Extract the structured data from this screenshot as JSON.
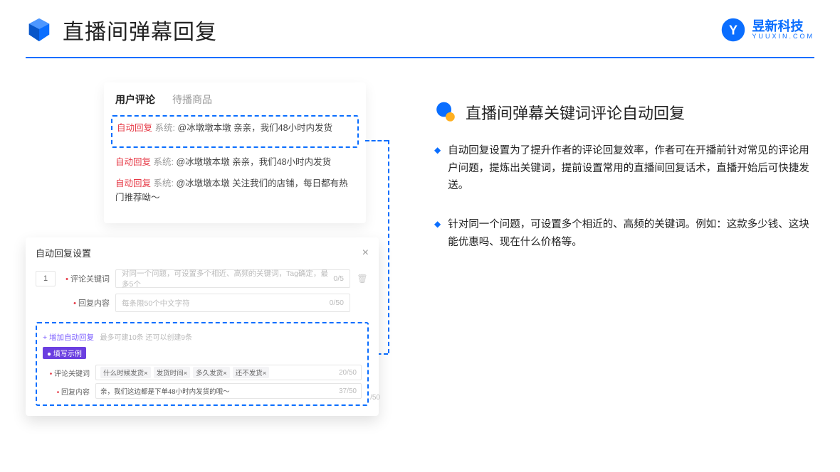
{
  "header": {
    "title": "直播间弹幕回复"
  },
  "logo": {
    "name": "昱新科技",
    "sub": "YUUXIN.COM"
  },
  "comments": {
    "tab_active": "用户评论",
    "tab_other": "待播商品",
    "items": [
      {
        "prefix": "自动回复",
        "sys": "系统:",
        "body": "@冰墩墩本墩 亲亲，我们48小时内发货"
      },
      {
        "prefix": "自动回复",
        "sys": "系统:",
        "body": "@冰墩墩本墩 亲亲，我们48小时内发货"
      },
      {
        "prefix": "自动回复",
        "sys": "系统:",
        "body": "@冰墩墩本墩 关注我们的店铺，每日都有热门推荐呦～"
      }
    ]
  },
  "settings": {
    "title": "自动回复设置",
    "rownum": "1",
    "kw_label": "评论关键词",
    "kw_placeholder": "对同一个问题，可设置多个相近、高频的关键词，Tag确定，最多5个",
    "kw_count": "0/5",
    "reply_label": "回复内容",
    "reply_placeholder": "每条限50个中文字符",
    "reply_count": "0/50",
    "add_link": "+ 增加自动回复",
    "add_hint": "最多可建10条 还可以创建9条",
    "example_badge": "● 填写示例",
    "ex_kw_label": "评论关键词",
    "ex_tags": [
      "什么时候发货×",
      "发货时间×",
      "多久发货×",
      "还不发货×"
    ],
    "ex_kw_count": "20/50",
    "ex_reply_label": "回复内容",
    "ex_reply_text": "亲，我们这边都是下单48小时内发货的哦～",
    "ex_reply_count": "37/50",
    "floating": "/50"
  },
  "section": {
    "title": "直播间弹幕关键词评论自动回复",
    "bullets": [
      "自动回复设置为了提升作者的评论回复效率，作者可在开播前针对常见的评论用户问题，提炼出关键词，提前设置常用的直播间回复话术，直播开始后可快捷发送。",
      "针对同一个问题，可设置多个相近的、高频的关键词。例如：这款多少钱、这块能优惠吗、现在什么价格等。"
    ]
  }
}
